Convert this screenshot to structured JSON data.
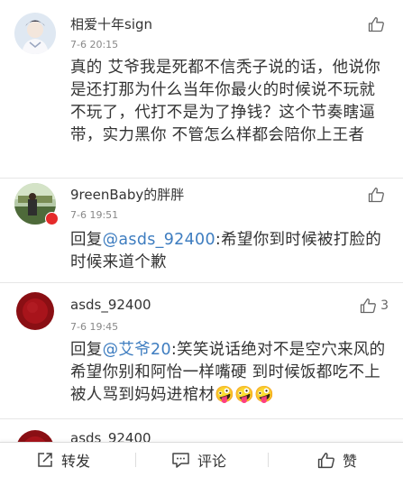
{
  "comments": [
    {
      "username": "相爱十年sign",
      "time": "7-6 20:15",
      "text": "真的 艾爷我是死都不信秃子说的话，他说你是还打那为什么当年你最火的时候说不玩就不玩了，代打不是为了挣钱？这个节奏瞎逼带，实力黑你  不管怎么样都会陪你上王者",
      "like_count": ""
    },
    {
      "username": "9reenBaby的胖胖",
      "time": "7-6 19:51",
      "reply_prefix": "回复",
      "mention": "@asds_92400",
      "text": ":希望你到时候被打脸的时候来道个歉",
      "like_count": ""
    },
    {
      "username": "asds_92400",
      "time": "7-6 19:45",
      "reply_prefix": "回复",
      "mention": "@艾爷20",
      "text": ":笑笑说话绝对不是空穴来风的  希望你别和阿怡一样嘴硬 到时候饭都吃不上 被人骂到妈妈进棺材",
      "emojis": [
        "🤪",
        "🤪",
        "🤪"
      ],
      "like_count": "3"
    },
    {
      "username": "asds_92400"
    }
  ],
  "toolbar": {
    "repost_label": "转发",
    "comment_label": "评论",
    "like_label": "赞"
  },
  "colors": {
    "mention": "#3e7dc0",
    "badge": "#e52a2a"
  }
}
